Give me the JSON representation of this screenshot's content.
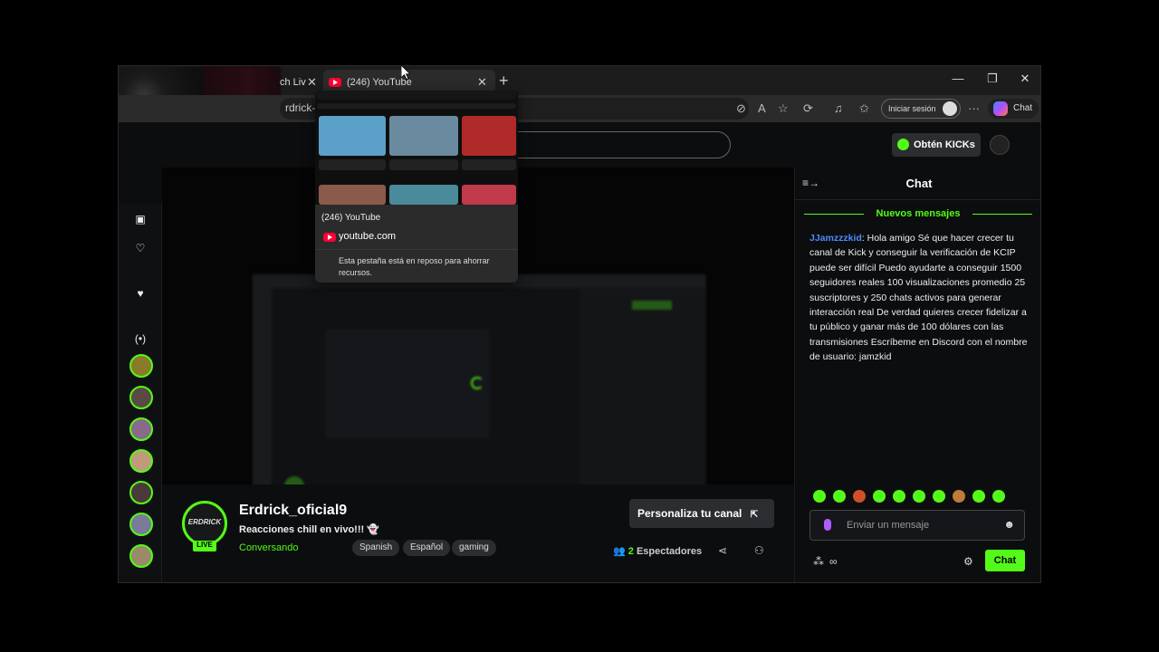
{
  "browser": {
    "tabs": [
      {
        "label": "ch Liv",
        "partial": true
      },
      {
        "label": "(246) YouTube",
        "active": true
      }
    ],
    "url_partial": "rdrick-of",
    "signin_label": "Iniciar sesión",
    "copilot_label": "Chat"
  },
  "tab_preview": {
    "title": "(246) YouTube",
    "domain": "youtube.com",
    "note": "Esta pestaña está en reposo para ahorrar recursos."
  },
  "header": {
    "kicks_label": "Obtén KICKs"
  },
  "channel": {
    "avatar_text": "ERDRICK",
    "live_badge": "LIVE",
    "name": "Erdrick_oficial9",
    "title": "Reacciones chill en vivo!!! 👻",
    "category": "Conversando",
    "tags": [
      "Spanish",
      "Español",
      "gaming"
    ],
    "customize_label": "Personaliza tu canal",
    "viewer_count": "2",
    "viewer_label": "Espectadores"
  },
  "chat": {
    "title": "Chat",
    "new_messages_label": "Nuevos mensajes",
    "message": {
      "user": "JJamzzzkid",
      "text": ": Hola amigo Sé que hacer crecer tu canal de Kick y conseguir la verificación de KCIP puede ser difícil Puedo ayudarte a conseguir 1500 seguidores reales 100 visualizaciones promedio 25 suscriptores y 250 chats activos para generar interacción real De verdad quieres crecer fidelizar a tu público y ganar más de 100 dólares con las transmisiones Escríbeme en Discord con el nombre de usuario: jamzkid"
    },
    "input_placeholder": "Enviar un mensaje",
    "send_label": "Chat",
    "points_label": "∞"
  },
  "colors": {
    "kick_green": "#53fc18",
    "username_blue": "#4a8cff",
    "youtube_red": "#ff0033"
  }
}
